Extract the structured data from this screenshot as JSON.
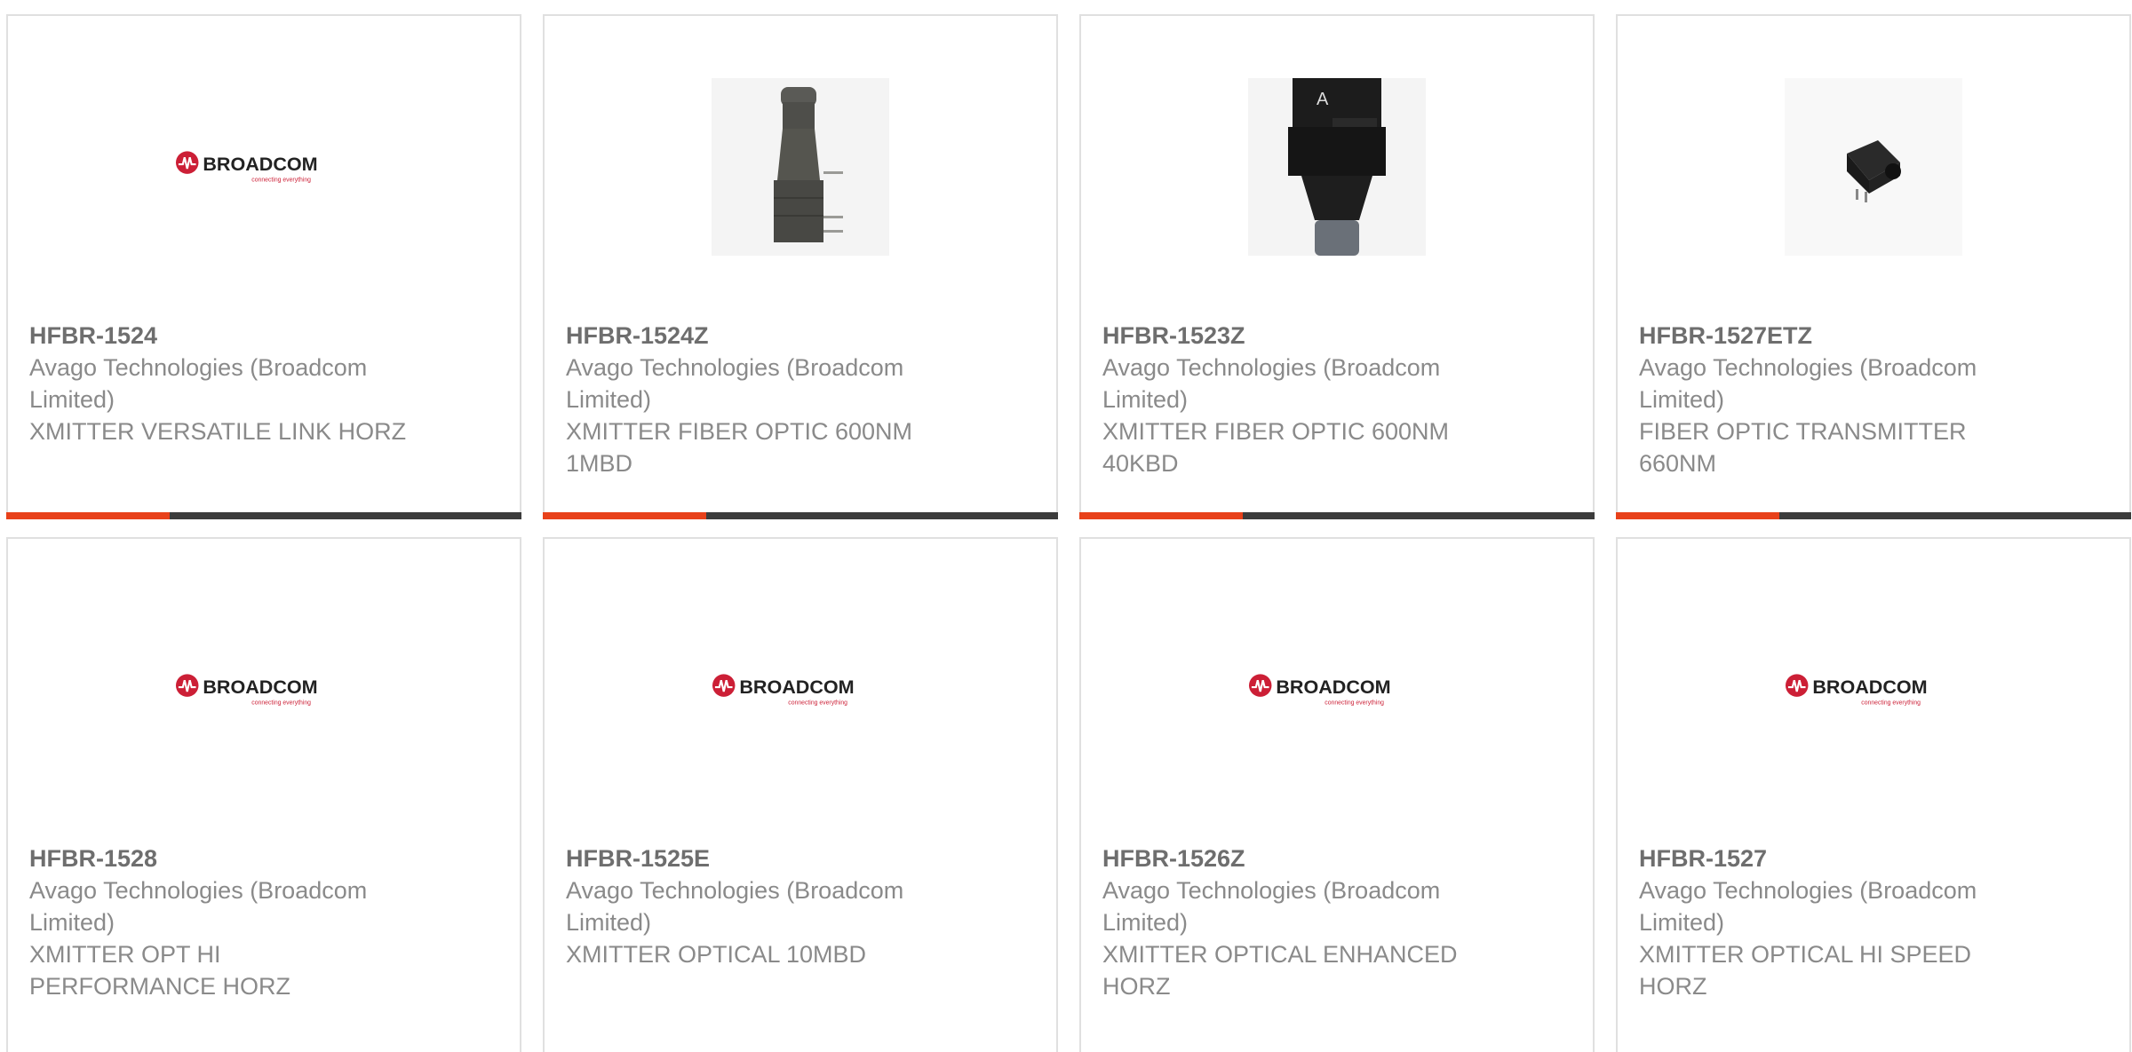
{
  "colors": {
    "accent": "#e8411a",
    "bar": "#3c3c3c",
    "brand_red": "#cc1f36"
  },
  "products": [
    {
      "part_number": "HFBR-1524",
      "manufacturer": "Avago Technologies (Broadcom Limited)",
      "description": "XMITTER VERSATILE LINK HORZ",
      "image": "broadcom-logo",
      "logo_text": "BROADCOM",
      "logo_tagline": "connecting everything"
    },
    {
      "part_number": "HFBR-1524Z",
      "manufacturer": "Avago Technologies (Broadcom Limited)",
      "description": "XMITTER FIBER OPTIC 600NM 1MBD",
      "image": "fiber-optic-transmitter-vertical-photo"
    },
    {
      "part_number": "HFBR-1523Z",
      "manufacturer": "Avago Technologies (Broadcom Limited)",
      "description": "XMITTER FIBER OPTIC 600NM 40KBD",
      "image": "fiber-optic-transmitter-black-photo"
    },
    {
      "part_number": "HFBR-1527ETZ",
      "manufacturer": "Avago Technologies (Broadcom Limited)",
      "description": "FIBER OPTIC TRANSMITTER 660NM",
      "image": "fiber-optic-transmitter-small-photo"
    },
    {
      "part_number": "HFBR-1528",
      "manufacturer": "Avago Technologies (Broadcom Limited)",
      "description": "XMITTER OPT HI PERFORMANCE HORZ",
      "image": "broadcom-logo",
      "logo_text": "BROADCOM",
      "logo_tagline": "connecting everything"
    },
    {
      "part_number": "HFBR-1525E",
      "manufacturer": "Avago Technologies (Broadcom Limited)",
      "description": "XMITTER OPTICAL 10MBD",
      "image": "broadcom-logo",
      "logo_text": "BROADCOM",
      "logo_tagline": "connecting everything"
    },
    {
      "part_number": "HFBR-1526Z",
      "manufacturer": "Avago Technologies (Broadcom Limited)",
      "description": "XMITTER OPTICAL ENHANCED HORZ",
      "image": "broadcom-logo",
      "logo_text": "BROADCOM",
      "logo_tagline": "connecting everything"
    },
    {
      "part_number": "HFBR-1527",
      "manufacturer": "Avago Technologies (Broadcom Limited)",
      "description": "XMITTER OPTICAL HI SPEED HORZ",
      "image": "broadcom-logo",
      "logo_text": "BROADCOM",
      "logo_tagline": "connecting everything"
    }
  ]
}
